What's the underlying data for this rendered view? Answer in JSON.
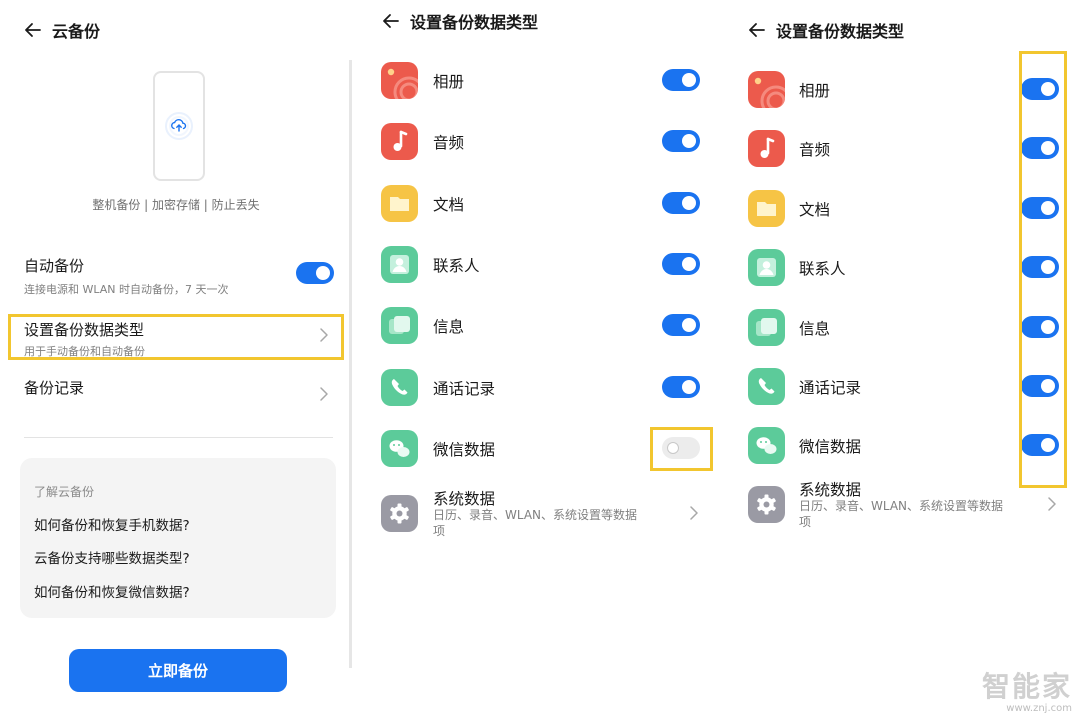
{
  "panel1": {
    "title": "云备份",
    "tagline": "整机备份 | 加密存储 | 防止丢失",
    "auto_backup": {
      "title": "自动备份",
      "subtitle": "连接电源和 WLAN 时自动备份，7 天一次",
      "enabled": true
    },
    "data_type": {
      "title": "设置备份数据类型",
      "subtitle": "用于手动备份和自动备份"
    },
    "history": {
      "title": "备份记录"
    },
    "faq": {
      "title": "了解云备份",
      "items": [
        "如何备份和恢复手机数据?",
        "云备份支持哪些数据类型?",
        "如何备份和恢复微信数据?"
      ]
    },
    "backup_button": "立即备份"
  },
  "panel2": {
    "title": "设置备份数据类型",
    "items": [
      {
        "label": "相册",
        "icon": "photo-icon",
        "enabled": true
      },
      {
        "label": "音频",
        "icon": "music-icon",
        "enabled": true
      },
      {
        "label": "文档",
        "icon": "folder-icon",
        "enabled": true
      },
      {
        "label": "联系人",
        "icon": "contact-icon",
        "enabled": true
      },
      {
        "label": "信息",
        "icon": "message-icon",
        "enabled": true
      },
      {
        "label": "通话记录",
        "icon": "phone-icon",
        "enabled": true
      },
      {
        "label": "微信数据",
        "icon": "wechat-icon",
        "enabled": false
      }
    ],
    "system": {
      "label": "系统数据",
      "desc_line1": "日历、录音、WLAN、系统设置等数据",
      "desc_line2": "项"
    }
  },
  "panel3": {
    "title": "设置备份数据类型",
    "items": [
      {
        "label": "相册",
        "icon": "photo-icon",
        "enabled": true
      },
      {
        "label": "音频",
        "icon": "music-icon",
        "enabled": true
      },
      {
        "label": "文档",
        "icon": "folder-icon",
        "enabled": true
      },
      {
        "label": "联系人",
        "icon": "contact-icon",
        "enabled": true
      },
      {
        "label": "信息",
        "icon": "message-icon",
        "enabled": true
      },
      {
        "label": "通话记录",
        "icon": "phone-icon",
        "enabled": true
      },
      {
        "label": "微信数据",
        "icon": "wechat-icon",
        "enabled": true
      }
    ],
    "system": {
      "label": "系统数据",
      "desc_line1": "日历、录音、WLAN、系统设置等数据",
      "desc_line2": "项"
    }
  },
  "watermark": {
    "logo": "智能家",
    "url": "www.znj.com"
  },
  "colors": {
    "accent": "#1a73f0",
    "highlight": "#f2c62f",
    "red": "#ec5a4c",
    "yellow": "#f6c445",
    "green": "#5ccb9a",
    "gray": "#9a9aa4"
  }
}
